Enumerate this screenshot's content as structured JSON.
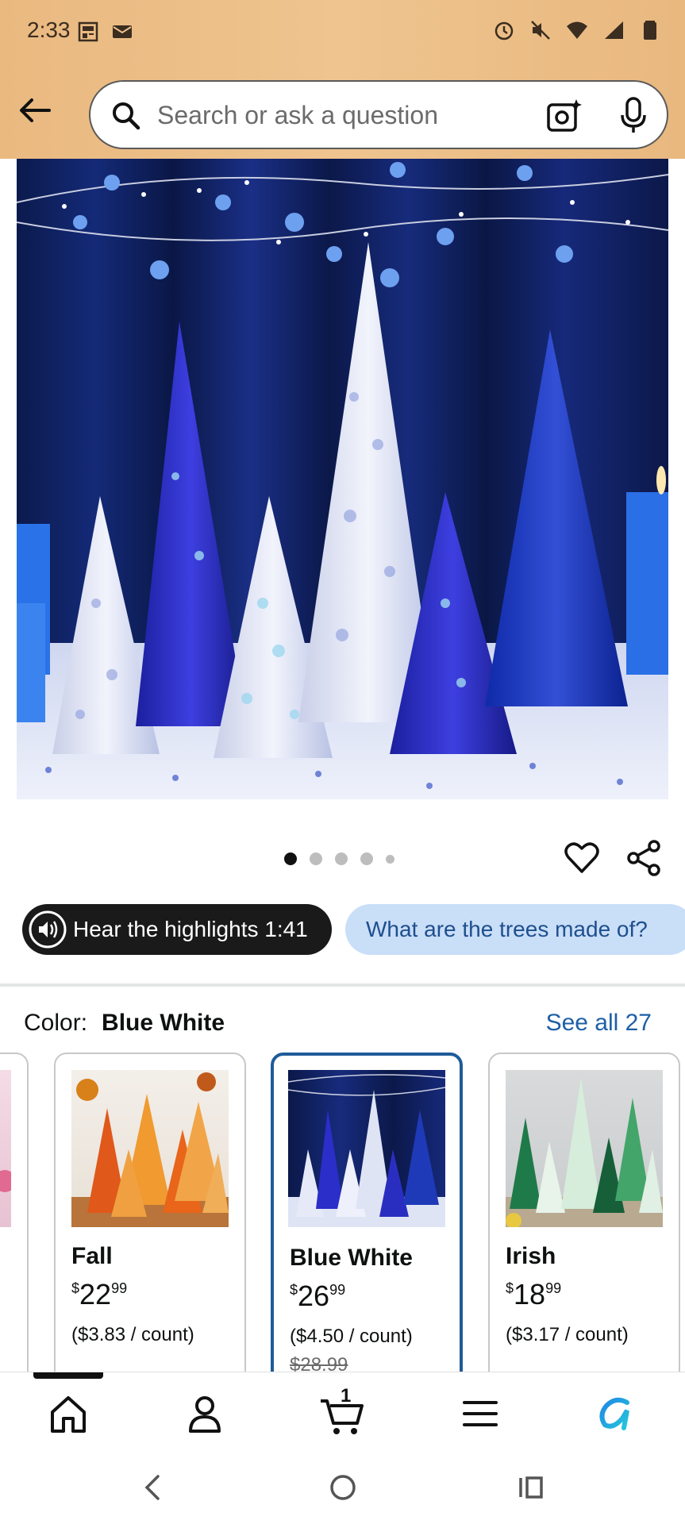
{
  "status_bar": {
    "time": "2:33"
  },
  "search": {
    "placeholder": "Search or ask a question"
  },
  "carousel": {
    "total": 5,
    "active_index": 0
  },
  "chips": {
    "audio": "Hear the highlights 1:41",
    "question": "What are the trees made of?"
  },
  "color": {
    "label": "Color:",
    "selected": "Blue White",
    "see_all": "See all 27"
  },
  "variants": [
    {
      "name": "Fall",
      "currency": "$",
      "price_whole": "22",
      "price_fraction": "99",
      "unit_price": "($3.83 / count)",
      "list_price": ""
    },
    {
      "name": "Blue White",
      "currency": "$",
      "price_whole": "26",
      "price_fraction": "99",
      "unit_price": "($4.50 / count)",
      "list_price": "$28.99",
      "selected": true
    },
    {
      "name": "Irish",
      "currency": "$",
      "price_whole": "18",
      "price_fraction": "99",
      "unit_price": "($3.17 / count)",
      "list_price": ""
    }
  ],
  "bottom_nav": {
    "cart_count": "1"
  },
  "colors": {
    "header_bg": "#efc48e",
    "link_blue": "#1e5fa6",
    "selected_border": "#1f5b99",
    "chip_question_bg": "#c9def7"
  }
}
